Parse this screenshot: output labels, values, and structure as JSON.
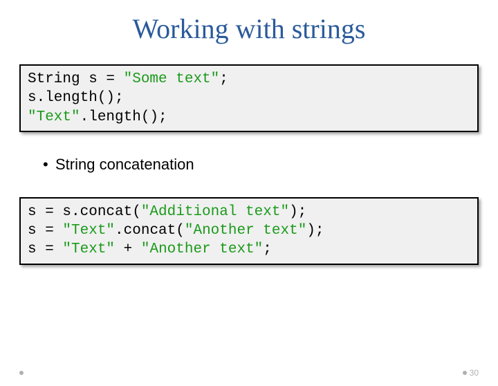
{
  "title": "Working with strings",
  "code1": {
    "line1a": "String s = ",
    "line1b": "\"Some text\"",
    "line1c": ";",
    "line2": "s.length();",
    "line3a": "\"Text\"",
    "line3b": ".length();"
  },
  "bullet": "String concatenation",
  "code2": {
    "l1a": "s = s.concat(",
    "l1b": "\"Additional text\"",
    "l1c": ");",
    "l2a": "s = ",
    "l2b": "\"Text\"",
    "l2c": ".concat(",
    "l2d": "\"Another text\"",
    "l2e": ");",
    "l3a": "s = ",
    "l3b": "\"Text\"",
    "l3c": " + ",
    "l3d": "\"Another text\"",
    "l3e": ";"
  },
  "page": "30"
}
